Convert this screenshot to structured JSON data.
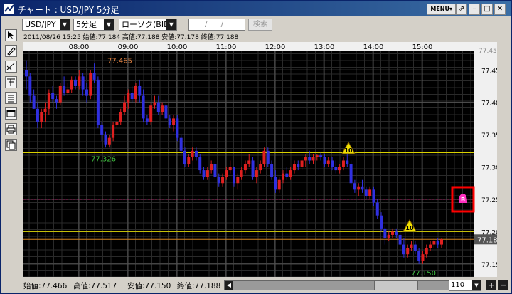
{
  "window": {
    "title": "チャート : USD/JPY 5分足",
    "menu_label": "MENU▾",
    "pin_icon": "pin-icon",
    "minimize_icon": "minimize-icon",
    "maximize_icon": "maximize-icon",
    "close_icon": "close-icon"
  },
  "toolbar": {
    "pair": "USD/JPY",
    "timeframe": "5分足",
    "candle_type": "ローソク(BID)",
    "date_placeholder": "/ /",
    "search_label": "検索"
  },
  "sidebar": {
    "tools": [
      "cursor-icon",
      "pencil-icon",
      "line-tool-icon",
      "text-tool-icon",
      "list-icon",
      "window-icon",
      "print-icon",
      "copy-icon"
    ]
  },
  "info": {
    "text": "2011/08/26 15:25 始値:77.184 高値:77.188 安値:77.178 終値:77.188"
  },
  "status": {
    "open": "始値:77.466",
    "high": "高値:77.517",
    "low": "安値:77.150",
    "close": "終値:77.188",
    "zoom": "110"
  },
  "chart_data": {
    "type": "candlestick",
    "x_ticks": [
      "08:00",
      "09:00",
      "10:00",
      "11:00",
      "12:00",
      "13:00",
      "14:00",
      "15:00"
    ],
    "y_ticks": [
      "77.450",
      "77.400",
      "77.350",
      "77.300",
      "77.250",
      "77.200",
      "77.150"
    ],
    "ylim": [
      77.13,
      77.48
    ],
    "top_partial_label": "77.450",
    "current_price": "77.188",
    "high_label": "77.465",
    "low_label": "77.150",
    "mid_label": "77.326",
    "grid": true,
    "horizontal_lines": [
      {
        "value": 77.322,
        "color": "#d8d000"
      },
      {
        "value": 77.2,
        "color": "#d8d000"
      },
      {
        "value": 77.188,
        "color": "#d08020"
      },
      {
        "value": 77.25,
        "color": "#b03070",
        "style": "dashed"
      }
    ],
    "alerts": [
      {
        "label": "10",
        "time": "13:27",
        "price": 77.325
      },
      {
        "label": "10",
        "time": "14:47",
        "price": 77.205
      }
    ],
    "alarm_marker": {
      "label": "B",
      "price": 77.25
    },
    "candles": [
      [
        77.45,
        77.465,
        77.42,
        77.44
      ],
      [
        77.44,
        77.445,
        77.4,
        77.41
      ],
      [
        77.41,
        77.42,
        77.39,
        77.39
      ],
      [
        77.39,
        77.4,
        77.36,
        77.37
      ],
      [
        77.37,
        77.39,
        77.36,
        77.385
      ],
      [
        77.385,
        77.4,
        77.37,
        77.39
      ],
      [
        77.39,
        77.42,
        77.38,
        77.415
      ],
      [
        77.415,
        77.425,
        77.4,
        77.405
      ],
      [
        77.405,
        77.41,
        77.39,
        77.4
      ],
      [
        77.4,
        77.43,
        77.395,
        77.425
      ],
      [
        77.425,
        77.44,
        77.41,
        77.415
      ],
      [
        77.415,
        77.43,
        77.41,
        77.42
      ],
      [
        77.42,
        77.44,
        77.415,
        77.435
      ],
      [
        77.435,
        77.44,
        77.42,
        77.425
      ],
      [
        77.425,
        77.45,
        77.42,
        77.44
      ],
      [
        77.44,
        77.445,
        77.41,
        77.42
      ],
      [
        77.42,
        77.43,
        77.4,
        77.41
      ],
      [
        77.41,
        77.45,
        77.405,
        77.445
      ],
      [
        77.445,
        77.46,
        77.43,
        77.435
      ],
      [
        77.435,
        77.44,
        77.36,
        77.365
      ],
      [
        77.365,
        77.37,
        77.34,
        77.35
      ],
      [
        77.35,
        77.355,
        77.33,
        77.335
      ],
      [
        77.335,
        77.35,
        77.33,
        77.345
      ],
      [
        77.345,
        77.37,
        77.34,
        77.365
      ],
      [
        77.365,
        77.375,
        77.36,
        77.37
      ],
      [
        77.37,
        77.39,
        77.365,
        77.385
      ],
      [
        77.385,
        77.41,
        77.38,
        77.4
      ],
      [
        77.4,
        77.42,
        77.39,
        77.415
      ],
      [
        77.415,
        77.425,
        77.4,
        77.405
      ],
      [
        77.405,
        77.43,
        77.4,
        77.425
      ],
      [
        77.425,
        77.435,
        77.4,
        77.41
      ],
      [
        77.41,
        77.42,
        77.37,
        77.375
      ],
      [
        77.375,
        77.38,
        77.365,
        77.37
      ],
      [
        77.37,
        77.4,
        77.365,
        77.395
      ],
      [
        77.395,
        77.41,
        77.39,
        77.4
      ],
      [
        77.4,
        77.41,
        77.38,
        77.385
      ],
      [
        77.385,
        77.4,
        77.38,
        77.395
      ],
      [
        77.395,
        77.405,
        77.37,
        77.375
      ],
      [
        77.375,
        77.38,
        77.36,
        77.365
      ],
      [
        77.365,
        77.38,
        77.355,
        77.375
      ],
      [
        77.375,
        77.38,
        77.34,
        77.345
      ],
      [
        77.345,
        77.35,
        77.32,
        77.325
      ],
      [
        77.325,
        77.33,
        77.3,
        77.305
      ],
      [
        77.305,
        77.32,
        77.3,
        77.315
      ],
      [
        77.315,
        77.33,
        77.31,
        77.325
      ],
      [
        77.325,
        77.33,
        77.31,
        77.315
      ],
      [
        77.315,
        77.32,
        77.29,
        77.295
      ],
      [
        77.295,
        77.3,
        77.28,
        77.285
      ],
      [
        77.285,
        77.3,
        77.28,
        77.295
      ],
      [
        77.295,
        77.31,
        77.29,
        77.305
      ],
      [
        77.305,
        77.31,
        77.28,
        77.285
      ],
      [
        77.285,
        77.29,
        77.27,
        77.275
      ],
      [
        77.275,
        77.29,
        77.27,
        77.285
      ],
      [
        77.285,
        77.3,
        77.28,
        77.295
      ],
      [
        77.295,
        77.31,
        77.29,
        77.3
      ],
      [
        77.3,
        77.3,
        77.27,
        77.275
      ],
      [
        77.275,
        77.29,
        77.265,
        77.285
      ],
      [
        77.285,
        77.3,
        77.28,
        77.295
      ],
      [
        77.295,
        77.31,
        77.29,
        77.305
      ],
      [
        77.305,
        77.32,
        77.3,
        77.31
      ],
      [
        77.31,
        77.315,
        77.28,
        77.285
      ],
      [
        77.285,
        77.3,
        77.275,
        77.295
      ],
      [
        77.295,
        77.31,
        77.29,
        77.305
      ],
      [
        77.305,
        77.33,
        77.3,
        77.325
      ],
      [
        77.325,
        77.33,
        77.3,
        77.305
      ],
      [
        77.305,
        77.31,
        77.28,
        77.285
      ],
      [
        77.285,
        77.295,
        77.26,
        77.265
      ],
      [
        77.265,
        77.285,
        77.26,
        77.28
      ],
      [
        77.28,
        77.295,
        77.275,
        77.29
      ],
      [
        77.29,
        77.3,
        77.28,
        77.285
      ],
      [
        77.285,
        77.3,
        77.28,
        77.295
      ],
      [
        77.295,
        77.31,
        77.29,
        77.305
      ],
      [
        77.305,
        77.31,
        77.295,
        77.3
      ],
      [
        77.3,
        77.315,
        77.295,
        77.31
      ],
      [
        77.31,
        77.32,
        77.3,
        77.315
      ],
      [
        77.315,
        77.325,
        77.305,
        77.31
      ],
      [
        77.31,
        77.32,
        77.305,
        77.315
      ],
      [
        77.315,
        77.32,
        77.31,
        77.318
      ],
      [
        77.318,
        77.322,
        77.31,
        77.315
      ],
      [
        77.315,
        77.32,
        77.3,
        77.305
      ],
      [
        77.305,
        77.315,
        77.3,
        77.31
      ],
      [
        77.31,
        77.315,
        77.295,
        77.3
      ],
      [
        77.3,
        77.31,
        77.29,
        77.295
      ],
      [
        77.295,
        77.305,
        77.29,
        77.3
      ],
      [
        77.3,
        77.315,
        77.295,
        77.31
      ],
      [
        77.31,
        77.32,
        77.3,
        77.305
      ],
      [
        77.305,
        77.31,
        77.27,
        77.275
      ],
      [
        77.275,
        77.28,
        77.26,
        77.265
      ],
      [
        77.265,
        77.275,
        77.255,
        77.27
      ],
      [
        77.27,
        77.28,
        77.26,
        77.265
      ],
      [
        77.265,
        77.27,
        77.25,
        77.255
      ],
      [
        77.255,
        77.27,
        77.25,
        77.265
      ],
      [
        77.265,
        77.27,
        77.24,
        77.245
      ],
      [
        77.245,
        77.25,
        77.22,
        77.225
      ],
      [
        77.225,
        77.23,
        77.2,
        77.205
      ],
      [
        77.205,
        77.21,
        77.18,
        77.19
      ],
      [
        77.19,
        77.2,
        77.185,
        77.195
      ],
      [
        77.195,
        77.205,
        77.19,
        77.2
      ],
      [
        77.2,
        77.205,
        77.19,
        77.195
      ],
      [
        77.195,
        77.2,
        77.17,
        77.18
      ],
      [
        77.18,
        77.19,
        77.16,
        77.165
      ],
      [
        77.165,
        77.18,
        77.16,
        77.175
      ],
      [
        77.175,
        77.185,
        77.17,
        77.18
      ],
      [
        77.18,
        77.185,
        77.165,
        77.17
      ],
      [
        77.17,
        77.175,
        77.15,
        77.155
      ],
      [
        77.155,
        77.17,
        77.15,
        77.165
      ],
      [
        77.165,
        77.18,
        77.16,
        77.175
      ],
      [
        77.175,
        77.185,
        77.17,
        77.18
      ],
      [
        77.18,
        77.19,
        77.175,
        77.185
      ],
      [
        77.185,
        77.19,
        77.175,
        77.18
      ],
      [
        77.18,
        77.19,
        77.175,
        77.188
      ]
    ]
  }
}
